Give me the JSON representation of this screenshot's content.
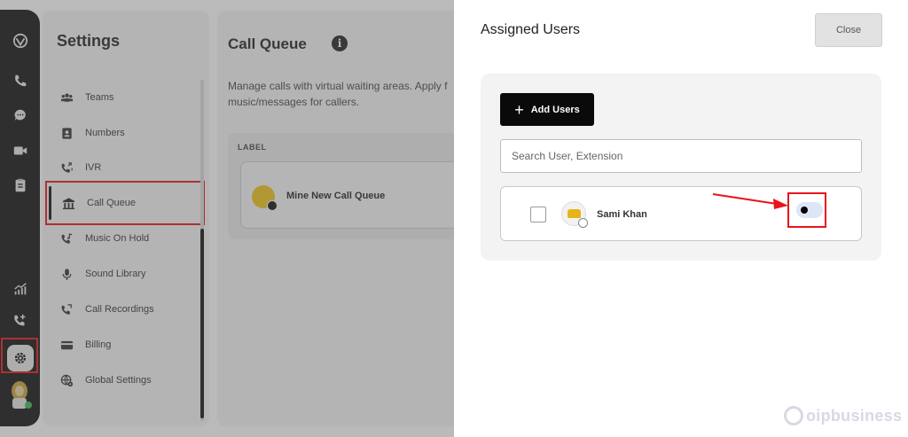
{
  "colors": {
    "rail_bg": "#111111",
    "highlight": "#e8141b",
    "primary_button": "#0a0a0a",
    "toggle_track": "#dde6f6",
    "overlay": "rgba(90,90,90,0.42)"
  },
  "rail": {
    "icons": [
      "logo-icon",
      "phone-icon",
      "chat-icon",
      "video-icon",
      "clipboard-icon",
      "analytics-icon",
      "call-settings-icon",
      "gear-icon",
      "user-avatar"
    ]
  },
  "settings": {
    "title": "Settings",
    "items": [
      {
        "label": "Teams",
        "icon": "teams-icon"
      },
      {
        "label": "Numbers",
        "icon": "numbers-icon"
      },
      {
        "label": "IVR",
        "icon": "ivr-icon"
      },
      {
        "label": "Call Queue",
        "icon": "call-queue-icon",
        "active": true
      },
      {
        "label": "Music On Hold",
        "icon": "music-on-hold-icon"
      },
      {
        "label": "Sound Library",
        "icon": "microphone-icon"
      },
      {
        "label": "Call Recordings",
        "icon": "call-recordings-icon"
      },
      {
        "label": "Billing",
        "icon": "billing-icon"
      },
      {
        "label": "Global Settings",
        "icon": "global-settings-icon"
      }
    ]
  },
  "call_queue": {
    "title": "Call Queue",
    "info_glyph": "i",
    "description": "Manage calls with virtual waiting areas. Apply f music/messages for callers.",
    "column_label": "LABEL",
    "queue_name": "Mine New Call Queue"
  },
  "drawer": {
    "title": "Assigned Users",
    "close_label": "Close",
    "add_users_label": "Add Users",
    "search_placeholder": "Search User, Extension",
    "users": [
      {
        "name": "Sami Khan",
        "checked": false,
        "toggle_on": false
      }
    ]
  },
  "watermark": "oipbusiness"
}
